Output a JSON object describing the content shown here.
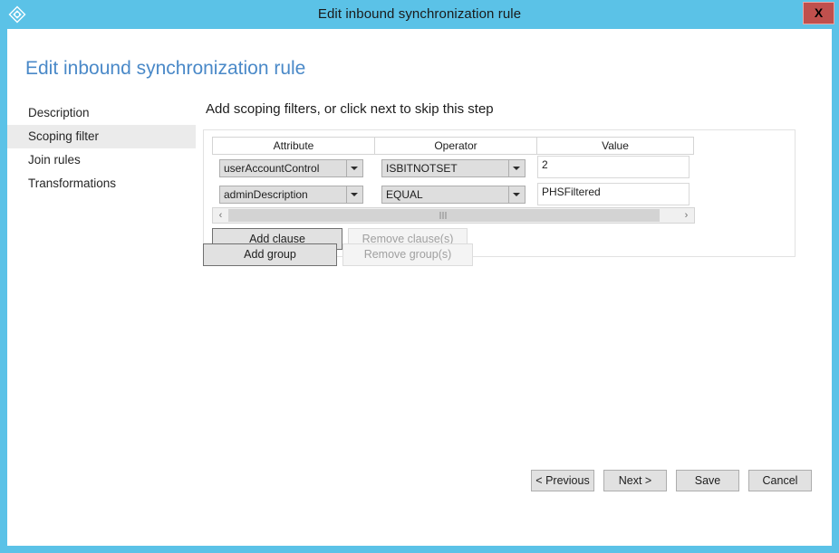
{
  "window": {
    "title": "Edit inbound synchronization rule",
    "icon": "azure-diamond-icon",
    "close_label": "X",
    "border_color": "#5bc2e7"
  },
  "page": {
    "title": "Edit inbound synchronization rule",
    "title_color": "#4a89c8"
  },
  "sidebar": {
    "items": [
      {
        "label": "Description",
        "selected": false
      },
      {
        "label": "Scoping filter",
        "selected": true
      },
      {
        "label": "Join rules",
        "selected": false
      },
      {
        "label": "Transformations",
        "selected": false
      }
    ]
  },
  "main": {
    "heading": "Add scoping filters, or click next to skip this step",
    "grid": {
      "columns": [
        "Attribute",
        "Operator",
        "Value"
      ],
      "rows": [
        {
          "attribute": "userAccountControl",
          "operator": "ISBITNOTSET",
          "value": "2"
        },
        {
          "attribute": "adminDescription",
          "operator": "EQUAL",
          "value": "PHSFiltered"
        }
      ]
    },
    "scrollbar": {
      "left_arrow": "‹",
      "right_arrow": "›"
    },
    "clause_buttons": {
      "add": "Add clause",
      "remove": "Remove clause(s)",
      "remove_disabled": true
    },
    "group_buttons": {
      "add": "Add group",
      "remove": "Remove group(s)",
      "remove_disabled": true
    }
  },
  "footer": {
    "buttons": [
      {
        "label": "< Previous"
      },
      {
        "label": "Next >"
      },
      {
        "label": "Save"
      },
      {
        "label": "Cancel"
      }
    ]
  }
}
